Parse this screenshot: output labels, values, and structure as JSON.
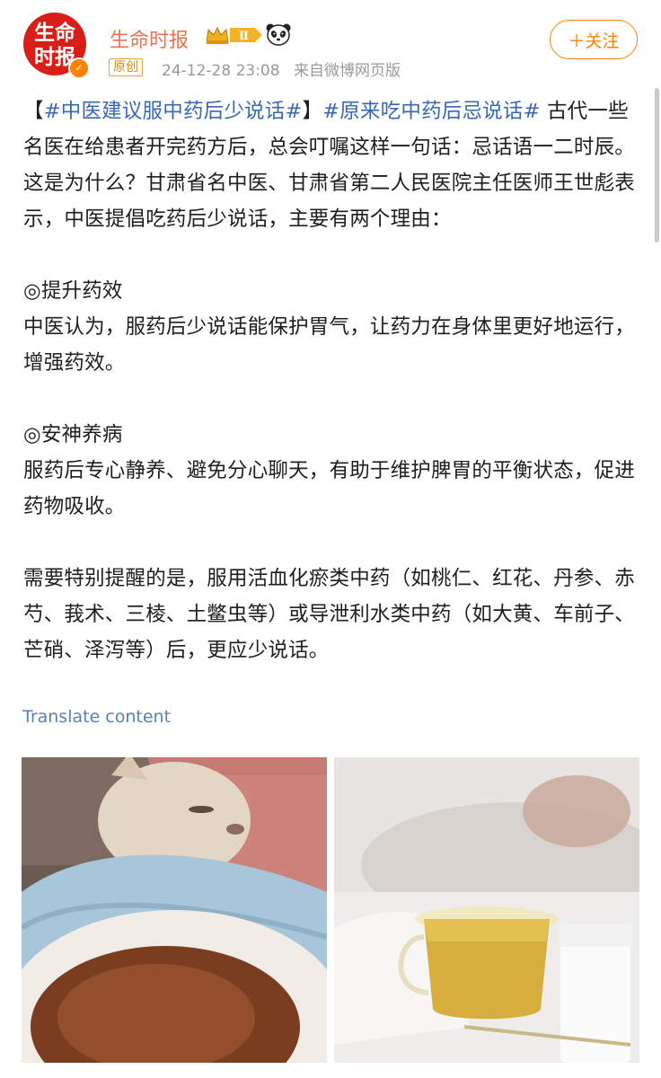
{
  "account": {
    "avatar_text": [
      "生命",
      "时报"
    ],
    "verified_icon": "verified-check-badge",
    "name": "生命时报",
    "level_badge": "Ⅱ",
    "level_icon": "crown-icon",
    "emoji_icon": "panda-icon",
    "original_badge": "原创",
    "timestamp": "24-12-28 23:08",
    "source": "来自微博网页版",
    "follow_label": "＋关注"
  },
  "post": {
    "intro": {
      "bracket_open": "【",
      "tag1": "#中医建议服中药后少说话#",
      "bracket_close": "】",
      "tag2": "#原来吃中药后忌说话#",
      "text": " 古代一些名医在给患者开完药方后，总会叮嘱这样一句话：忌话语一二时辰。这是为什么？甘肃省名中医、甘肃省第二人民医院主任医师王世彪表示，中医提倡吃药后少说话，主要有两个理由："
    },
    "section1_title": "◎提升药效",
    "section1_body": "中医认为，服药后少说话能保护胃气，让药力在身体里更好地运行，增强药效。",
    "section2_title": "◎安神养病",
    "section2_body": "服药后专心静养、避免分心聊天，有助于维护脾胃的平衡状态，促进药物吸收。",
    "note": "需要特别提醒的是，服用活血化瘀类中药（如桃仁、红花、丹参、赤芍、莪术、三棱、土鳖虫等）或导泄利水类中药（如大黄、车前子、芒硝、泽泻等）后，更应少说话。"
  },
  "translate_label": "Translate content",
  "images": [
    {
      "name": "cat-under-blanket-photo"
    },
    {
      "name": "herbal-tea-cup-photo"
    }
  ],
  "colors": {
    "accent_orange": "#ff8200",
    "username": "#eb7350",
    "hashtag": "#3a67b4",
    "avatar_red": "#d91e18"
  }
}
